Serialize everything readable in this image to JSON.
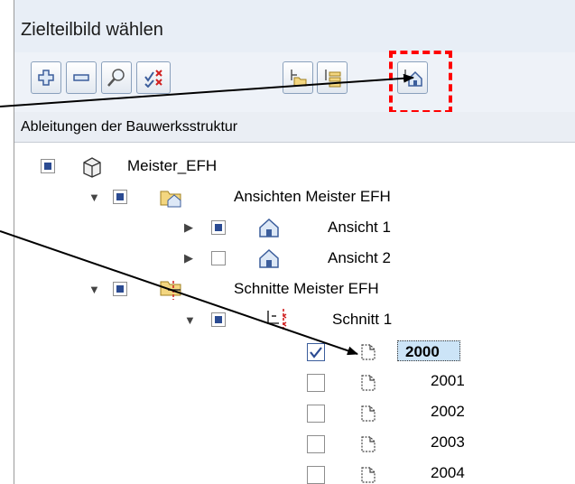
{
  "window": {
    "title": "Zielteilbild wählen"
  },
  "toolbar": {
    "buttons": [
      {
        "icon": "expand-all-icon"
      },
      {
        "icon": "collapse-all-icon"
      },
      {
        "icon": "search-icon"
      },
      {
        "icon": "deselect-all-icon"
      },
      {
        "icon": "structure-folder-icon"
      },
      {
        "icon": "structure-levels-icon"
      },
      {
        "icon": "house-view-icon"
      }
    ]
  },
  "tree": {
    "header": "Ableitungen der Bauwerksstruktur",
    "root": {
      "label": "Meister_EFH"
    },
    "ansichten": {
      "label": "Ansichten Meister EFH"
    },
    "ansicht1": {
      "label": "Ansicht 1"
    },
    "ansicht2": {
      "label": "Ansicht 2"
    },
    "schnitte": {
      "label": "Schnitte Meister EFH"
    },
    "schnitt1": {
      "label": "Schnitt 1"
    },
    "drawings": [
      {
        "label": "2000",
        "checked": true,
        "selected": true
      },
      {
        "label": "2001",
        "checked": false
      },
      {
        "label": "2002",
        "checked": false
      },
      {
        "label": "2003",
        "checked": false
      },
      {
        "label": "2004",
        "checked": false
      }
    ]
  },
  "colors": {
    "highlight": "#ff0000",
    "arrow": "#000000",
    "selection": "#cce4f7"
  }
}
